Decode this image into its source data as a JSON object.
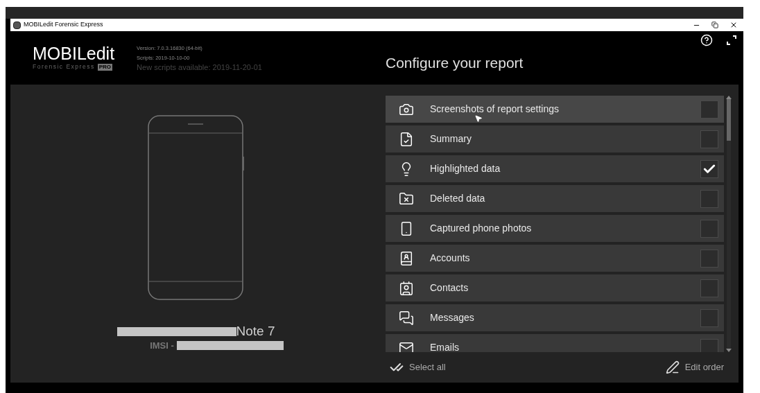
{
  "window": {
    "title": "MOBILedit Forensic Express"
  },
  "header": {
    "logo": "MOBILedit",
    "logo_sub": "Forensic Express",
    "logo_badge": "PRO",
    "version": "Version: 7.0.3.16830 (64-bit)",
    "scripts": "Scripts: 2019-10-10-00",
    "new_scripts": "New scripts available: 2019-11-20-01",
    "title": "Configure your report"
  },
  "device": {
    "name": "Note 7",
    "imsi_label": "IMSI -"
  },
  "report_items": [
    {
      "kind": "camera",
      "label": "Screenshots of report settings",
      "checked": false,
      "hovered": true
    },
    {
      "kind": "summary",
      "label": "Summary",
      "checked": false,
      "hovered": false
    },
    {
      "kind": "bulb",
      "label": "Highlighted data",
      "checked": true,
      "hovered": false
    },
    {
      "kind": "deleted",
      "label": "Deleted data",
      "checked": false,
      "hovered": false
    },
    {
      "kind": "photos",
      "label": "Captured phone photos",
      "checked": false,
      "hovered": false
    },
    {
      "kind": "accounts",
      "label": "Accounts",
      "checked": false,
      "hovered": false
    },
    {
      "kind": "contacts",
      "label": "Contacts",
      "checked": false,
      "hovered": false
    },
    {
      "kind": "messages",
      "label": "Messages",
      "checked": false,
      "hovered": false
    },
    {
      "kind": "emails",
      "label": "Emails",
      "checked": false,
      "hovered": false
    }
  ],
  "footer": {
    "select_all": "Select all",
    "edit_order": "Edit order"
  }
}
